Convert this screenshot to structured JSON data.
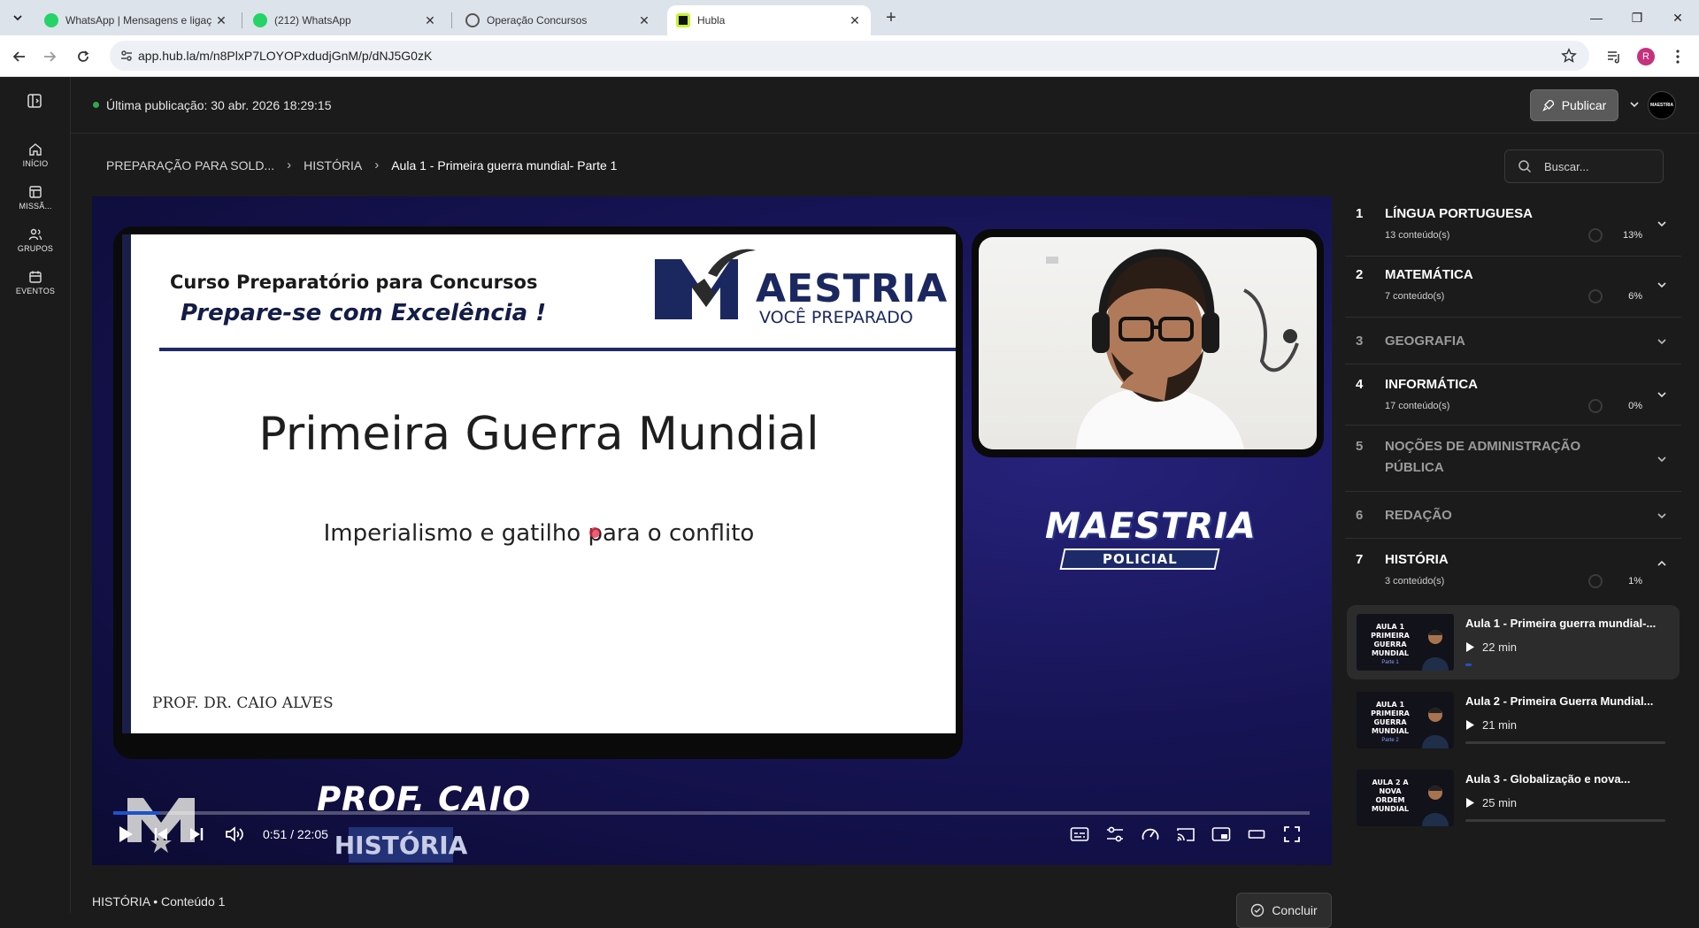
{
  "browser": {
    "tabs": [
      {
        "title": "WhatsApp | Mensagens e ligaç",
        "icon": "whatsapp-icon"
      },
      {
        "title": "(212) WhatsApp",
        "icon": "whatsapp-icon"
      },
      {
        "title": "Operação Concursos",
        "icon": "globe-icon"
      },
      {
        "title": "Hubla",
        "icon": "hubla-icon",
        "active": true
      }
    ],
    "url": "app.hub.la/m/n8PlxP7LOYOPxdudjGnM/p/dNJ5G0zK",
    "profile_initial": "R",
    "colors": {
      "chrome": "#dde3ea",
      "profile": "#c5317d"
    }
  },
  "rail": {
    "items": [
      {
        "label": "INÍCIO",
        "icon": "home-icon"
      },
      {
        "label": "MISSÃ...",
        "icon": "layout-icon"
      },
      {
        "label": "GRUPOS",
        "icon": "users-icon"
      },
      {
        "label": "EVENTOS",
        "icon": "calendar-icon"
      }
    ]
  },
  "topbar": {
    "last_published": "Última publicação: 30 abr. 2026 18:29:15",
    "publish_label": "Publicar",
    "brand_avatar": "MAESTRIA"
  },
  "breadcrumb": {
    "items": [
      "PREPARAÇÃO PARA SOLD...",
      "HISTÓRIA",
      "Aula 1 - Primeira guerra mundial- Parte 1"
    ]
  },
  "search": {
    "placeholder": "Buscar..."
  },
  "video": {
    "slide": {
      "course": "Curso Preparatório para Concursos",
      "motto": "Prepare-se com Excelência !",
      "logo_name": "AESTRIA",
      "logo_tag": "VOCÊ PREPARADO",
      "headline": "Primeira Guerra Mundial",
      "subline": "Imperialismo e gatilho para o conflito",
      "prof": "PROF. DR. CAIO ALVES"
    },
    "brand": {
      "name": "MAESTRIA",
      "ribbon": "POLICIAL"
    },
    "lower_third": {
      "prof": "PROF. CAIO",
      "subject": "HISTÓRIA"
    },
    "current_time": "0:51",
    "duration": "22:05",
    "progress": 0.0385,
    "colors": {
      "progress": "#1e53c9",
      "background": "#171456"
    }
  },
  "modules": [
    {
      "num": "1",
      "title": "LÍNGUA PORTUGUESA",
      "count": "13 conteúdo(s)",
      "pct": "13%",
      "expanded": false,
      "dim": false
    },
    {
      "num": "2",
      "title": "MATEMÁTICA",
      "count": "7 conteúdo(s)",
      "pct": "6%",
      "expanded": false,
      "dim": false
    },
    {
      "num": "3",
      "title": "GEOGRAFIA",
      "count": "",
      "pct": "",
      "expanded": false,
      "dim": true
    },
    {
      "num": "4",
      "title": "INFORMÁTICA",
      "count": "17 conteúdo(s)",
      "pct": "0%",
      "expanded": false,
      "dim": false
    },
    {
      "num": "5",
      "title": "NOÇÕES DE ADMINISTRAÇÃO PÚBLICA",
      "count": "",
      "pct": "",
      "expanded": false,
      "dim": true
    },
    {
      "num": "6",
      "title": "REDAÇÃO",
      "count": "",
      "pct": "",
      "expanded": false,
      "dim": true
    },
    {
      "num": "7",
      "title": "HISTÓRIA",
      "count": "3 conteúdo(s)",
      "pct": "1%",
      "expanded": true,
      "dim": false
    }
  ],
  "lessons": [
    {
      "title": "Aula 1 - Primeira guerra mundial-...",
      "duration": "22 min",
      "progress": 0.03,
      "active": true,
      "thumb_title": "AULA 1 PRIMEIRA GUERRA MUNDIAL",
      "thumb_part": "Parte 1"
    },
    {
      "title": "Aula 2 - Primeira Guerra Mundial...",
      "duration": "21 min",
      "progress": 0,
      "active": false,
      "thumb_title": "AULA 1 PRIMEIRA GUERRA MUNDIAL",
      "thumb_part": "Parte 2"
    },
    {
      "title": "Aula 3 - Globalização e nova...",
      "duration": "25 min",
      "progress": 0,
      "active": false,
      "thumb_title": "AULA 2 A NOVA ORDEM MUNDIAL",
      "thumb_part": ""
    }
  ],
  "footer": {
    "label": "HISTÓRIA • Conteúdo 1",
    "conclude_label": "Concluir"
  }
}
